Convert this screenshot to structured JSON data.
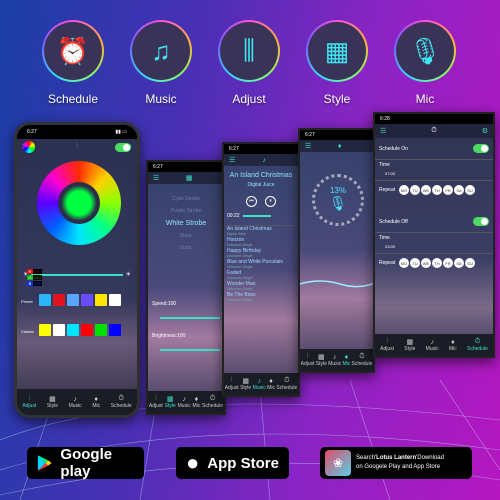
{
  "features": [
    {
      "label": "Schedule",
      "icon": "alarm-clock-icon"
    },
    {
      "label": "Music",
      "icon": "music-note-icon"
    },
    {
      "label": "Adjust",
      "icon": "sliders-icon"
    },
    {
      "label": "Style",
      "icon": "grid-icon"
    },
    {
      "label": "Mic",
      "icon": "microphone-icon"
    }
  ],
  "tabs": [
    "Adjust",
    "Style",
    "Music",
    "Mic",
    "Schedule"
  ],
  "adjust": {
    "time": "6:27",
    "rgb": [
      {
        "k": "R",
        "v": "0"
      },
      {
        "k": "G",
        "v": "214"
      },
      {
        "k": "B",
        "v": "255"
      }
    ],
    "preset_label": "Preset",
    "classic_label": "Classic",
    "preset_colors": [
      "#29b6ff",
      "#e0141e",
      "#58a6ff",
      "#6a4cff",
      "#ffe600",
      "#ffffff"
    ],
    "classic_colors": [
      "#ffff00",
      "#ffffff",
      "#00e5ff",
      "#ff0000",
      "#00e000",
      "#0000ff"
    ]
  },
  "style": {
    "time": "6:27",
    "modes": [
      "Cyan Strobe",
      "Purple Strobe",
      "White Strobe",
      "Static",
      "Static"
    ],
    "speed": "Speed:100",
    "brightness": "Brightness:100"
  },
  "music": {
    "time": "6:27",
    "title": "An Island Christmas",
    "artist": "Digital Juice",
    "elapsed": "00:22",
    "songs": [
      {
        "t": "An Island Christmas",
        "a": "Digital Juice"
      },
      {
        "t": "Horizon",
        "a": "Unknown Singer"
      },
      {
        "t": "Happy Birthday",
        "a": "Unknown Singer"
      },
      {
        "t": "Blue and White Porcelain",
        "a": "Unknown Singer"
      },
      {
        "t": "Faded",
        "a": "Unknown Singer"
      },
      {
        "t": "Wonder Man",
        "a": "Unknown Singer"
      },
      {
        "t": "Be The Boss",
        "a": "Unknown Singer"
      }
    ]
  },
  "mic": {
    "time": "6:27",
    "level": "13%",
    "level_value": 13
  },
  "schedule": {
    "time": "6:28",
    "on_label": "Schedule On",
    "off_label": "Schedule Off",
    "time_label": "Time",
    "on_time": "07:00",
    "off_time": "23:00",
    "repeat_label": "Repeat",
    "days": [
      "MO",
      "TU",
      "WE",
      "TH",
      "FR",
      "SA",
      "SU"
    ]
  },
  "badges": {
    "google": "Google play",
    "apple": "App Store",
    "lotus_pre": "Search'",
    "lotus_name": "Lotus Lantern",
    "lotus_post": "'Download",
    "lotus_line2": "on Googele Play and App Store"
  }
}
